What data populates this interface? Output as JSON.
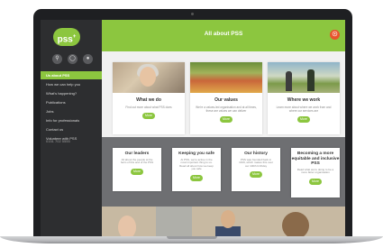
{
  "sidebar": {
    "logo_text": "pss",
    "logo_mark": "+",
    "icons": [
      "search-icon",
      "globe-icon",
      "user-icon"
    ],
    "nav": [
      {
        "label": "Us about PSS",
        "active": true
      },
      {
        "label": "How we can help you",
        "active": false
      },
      {
        "label": "What's happening?",
        "active": false
      },
      {
        "label": "Publications",
        "active": false
      },
      {
        "label": "Jobs",
        "active": false
      },
      {
        "label": "Info for professionals",
        "active": false
      },
      {
        "label": "Contact us",
        "active": false
      },
      {
        "label": "Volunteer with PSS",
        "active": false
      }
    ],
    "phone": "0151 702 5555"
  },
  "header": {
    "title": "All about PSS",
    "accessibility_icon": "accessibility-icon"
  },
  "row1": [
    {
      "title": "What we do",
      "text": "Find out more about what PSS does",
      "button": "More"
    },
    {
      "title": "Our values",
      "text": "We're a values-led organisation and at all times, these are values we can deliver",
      "button": "More"
    },
    {
      "title": "Where we work",
      "text": "Learn more about where we work from and where our services are",
      "button": "More"
    }
  ],
  "row2": [
    {
      "title": "Our leaders",
      "text": "All about the people at the helm of this and of the PSS",
      "button": "More"
    },
    {
      "title": "Keeping you safe",
      "text": "At PSS, we're active in the most important thing to us. Read all about how we keep you safe",
      "button": "More"
    },
    {
      "title": "Our history",
      "text": "PSS was founded back in 1919, which makes this over our 100th birthday",
      "button": "More"
    },
    {
      "title": "Becoming a more equitable and inclusive PSS",
      "text": "Read what we're doing to be a more fairer organisation",
      "button": "More"
    }
  ],
  "colors": {
    "brand_green": "#8cc63f",
    "sidebar_bg": "#2d2e30",
    "accent_orange": "#e8542e"
  }
}
